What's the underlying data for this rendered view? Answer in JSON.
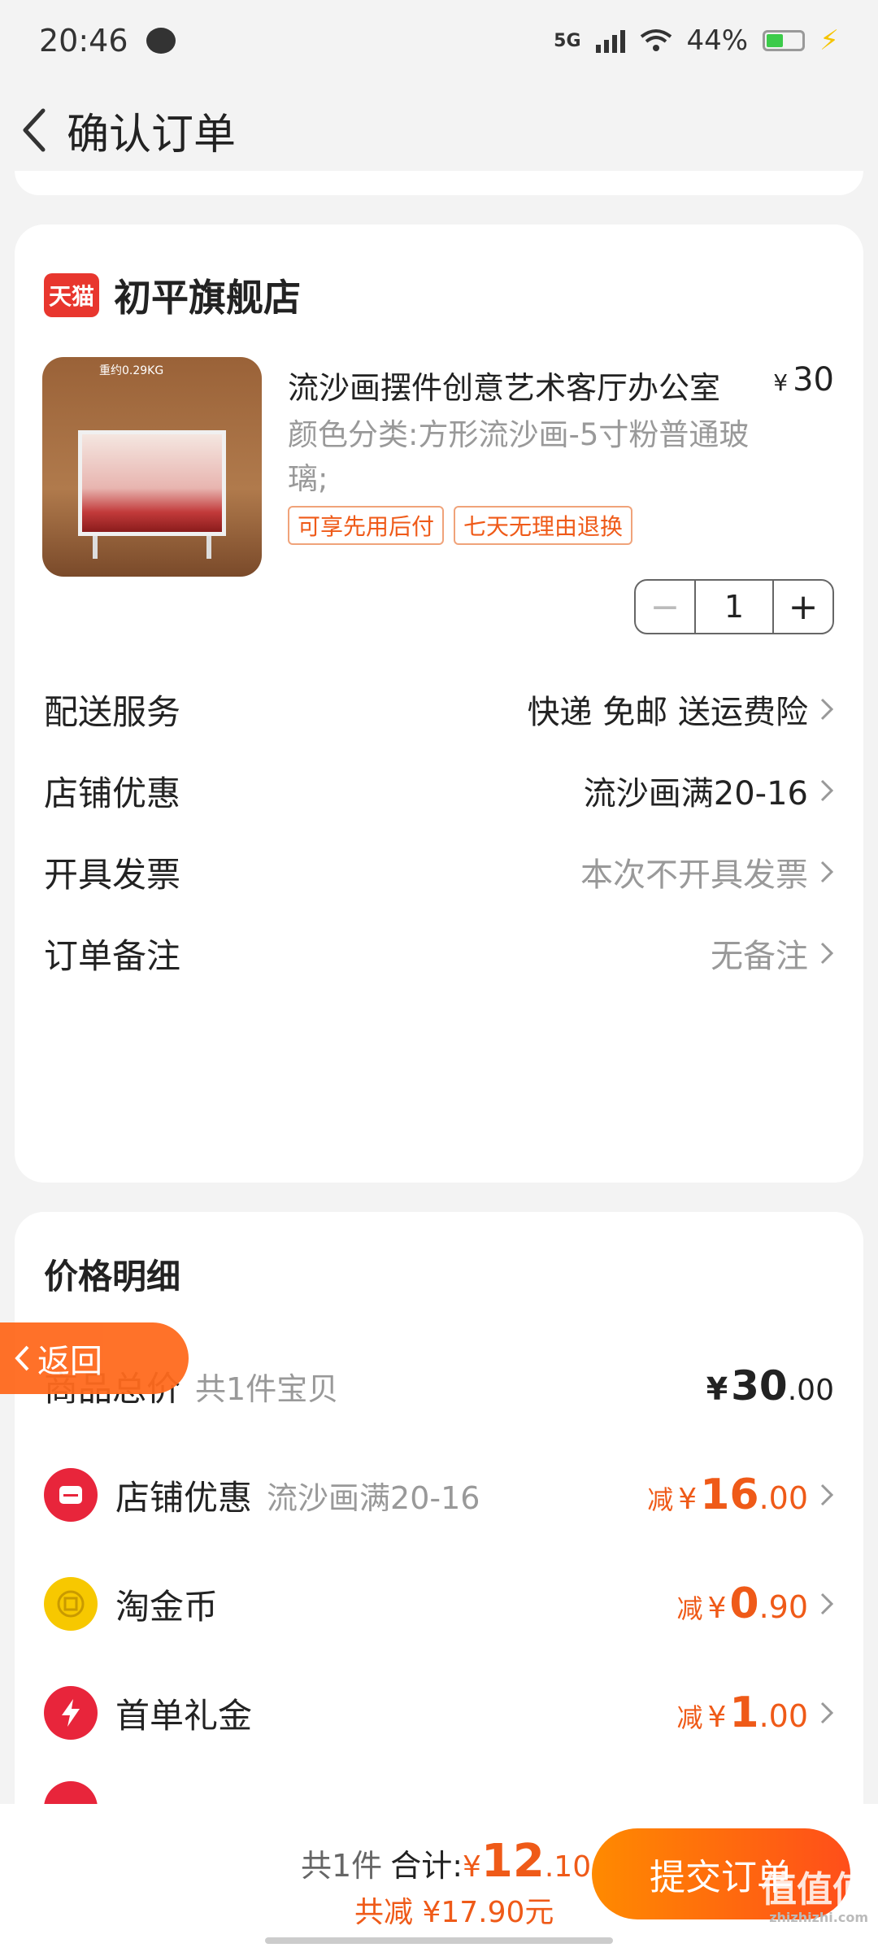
{
  "status": {
    "time": "20:46",
    "network": "5G",
    "battery": "44%"
  },
  "header": {
    "title": "确认订单"
  },
  "store": {
    "badge": "天猫",
    "name": "初平旗舰店",
    "product": {
      "title": "流沙画摆件创意艺术客厅办公室",
      "yen": "¥",
      "price": "30",
      "spec": "颜色分类:方形流沙画-5寸粉普通玻璃;",
      "image_label": "重约0.29KG",
      "tags": [
        "可享先用后付",
        "七天无理由退换"
      ],
      "quantity": "1"
    },
    "rows": [
      {
        "label": "配送服务",
        "value": "快递 免邮 送运费险"
      },
      {
        "label": "店铺优惠",
        "value": "流沙画满20-16"
      },
      {
        "label": "开具发票",
        "value": "本次不开具发票"
      },
      {
        "label": "订单备注",
        "value": "无备注"
      }
    ]
  },
  "price": {
    "title": "价格明细",
    "total": {
      "label": "商品总价",
      "sub": "共1件宝贝",
      "yen": "¥",
      "int": "30",
      "dec": ".00"
    },
    "items": [
      {
        "label": "店铺优惠",
        "sub": "流沙画满20-16",
        "jian": "减",
        "yen": "¥",
        "int": "16",
        "dec": ".00"
      },
      {
        "label": "淘金币",
        "sub": "",
        "jian": "减",
        "yen": "¥",
        "int": "0",
        "dec": ".90"
      },
      {
        "label": "首单礼金",
        "sub": "",
        "jian": "减",
        "yen": "¥",
        "int": "1",
        "dec": ".00"
      }
    ]
  },
  "float_back": "返回",
  "footer": {
    "count": "共1件",
    "total_label": "合计:",
    "yen": "¥",
    "int": "12",
    "dec": ".10",
    "saved": "共减 ¥17.90元",
    "submit": "提交订单",
    "watermark": "值值值",
    "watermark_url": "zhizhizhi.com"
  },
  "colors": {
    "accent": "#ef5a18",
    "tmall_red": "#e8362e",
    "background": "#f3f3f3"
  }
}
